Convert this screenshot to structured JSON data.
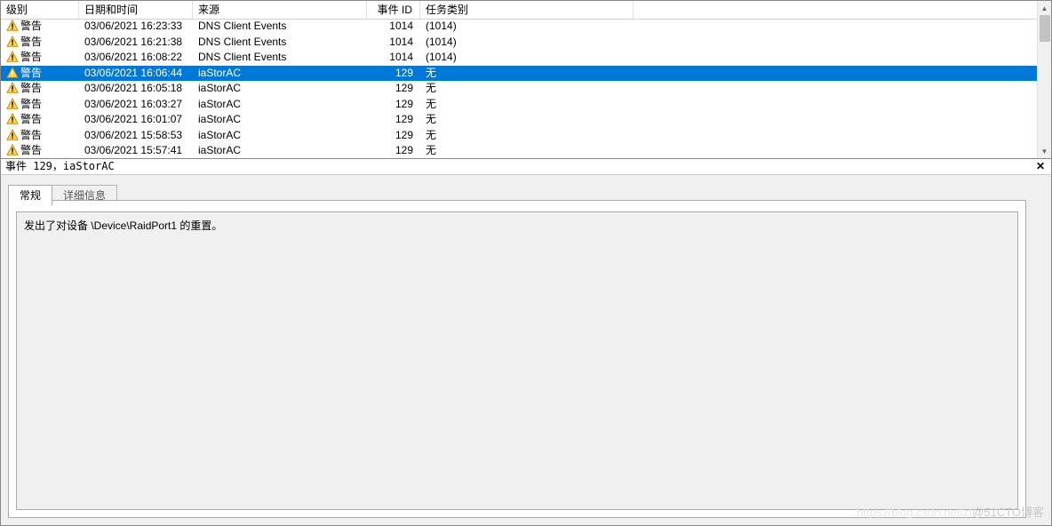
{
  "columns": {
    "level": "级别",
    "datetime": "日期和时间",
    "source": "来源",
    "event_id": "事件 ID",
    "category": "任务类别"
  },
  "level_label": "警告",
  "level_label_sel": "警告",
  "rows": [
    {
      "sel": false,
      "datetime": "03/06/2021 16:23:33",
      "source": "DNS Client Events",
      "id": "1014",
      "cat": "(1014)"
    },
    {
      "sel": false,
      "datetime": "03/06/2021 16:21:38",
      "source": "DNS Client Events",
      "id": "1014",
      "cat": "(1014)"
    },
    {
      "sel": false,
      "datetime": "03/06/2021 16:08:22",
      "source": "DNS Client Events",
      "id": "1014",
      "cat": "(1014)"
    },
    {
      "sel": true,
      "datetime": "03/06/2021 16:06:44",
      "source": "iaStorAC",
      "id": "129",
      "cat": "无"
    },
    {
      "sel": false,
      "datetime": "03/06/2021 16:05:18",
      "source": "iaStorAC",
      "id": "129",
      "cat": "无"
    },
    {
      "sel": false,
      "datetime": "03/06/2021 16:03:27",
      "source": "iaStorAC",
      "id": "129",
      "cat": "无"
    },
    {
      "sel": false,
      "datetime": "03/06/2021 16:01:07",
      "source": "iaStorAC",
      "id": "129",
      "cat": "无"
    },
    {
      "sel": false,
      "datetime": "03/06/2021 15:58:53",
      "source": "iaStorAC",
      "id": "129",
      "cat": "无"
    },
    {
      "sel": false,
      "datetime": "03/06/2021 15:57:41",
      "source": "iaStorAC",
      "id": "129",
      "cat": "无"
    }
  ],
  "midbar_title": "事件 129，iaStorAC",
  "tabs": {
    "general": "常规",
    "details": "详细信息"
  },
  "detail_text": "发出了对设备 \\Device\\RaidPort1 的重置。",
  "watermark_faint": "https://blog.csdn.net/zt",
  "watermark": "@51CTO博客"
}
